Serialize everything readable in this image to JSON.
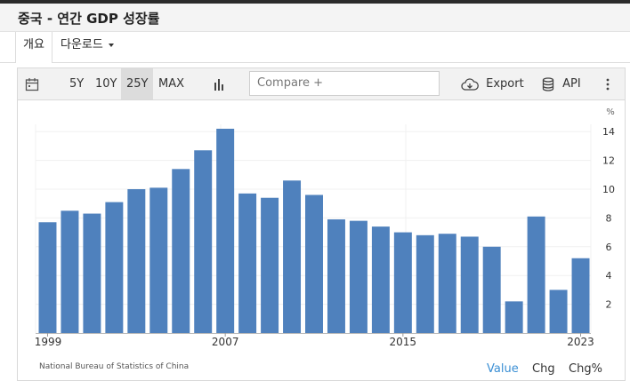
{
  "page": {
    "title": "중국 - 연간 GDP 성장률"
  },
  "tabs": {
    "overview": "개요",
    "download": "다운로드"
  },
  "toolbar": {
    "calendar_icon": "calendar-icon",
    "ranges": [
      "5Y",
      "10Y",
      "25Y",
      "MAX"
    ],
    "active_range": "25Y",
    "chart_type_icon": "bar-chart-icon",
    "compare_placeholder": "Compare +",
    "export_label": "Export",
    "export_icon": "cloud-download-icon",
    "api_label": "API",
    "api_icon": "database-icon",
    "more_icon": "vertical-dots-icon"
  },
  "chart_data": {
    "type": "bar",
    "title": "",
    "unit_label": "%",
    "categories": [
      "1999",
      "2000",
      "2001",
      "2002",
      "2003",
      "2004",
      "2005",
      "2006",
      "2007",
      "2008",
      "2009",
      "2010",
      "2011",
      "2012",
      "2013",
      "2014",
      "2015",
      "2016",
      "2017",
      "2018",
      "2019",
      "2020",
      "2021",
      "2022",
      "2023"
    ],
    "values": [
      7.7,
      8.5,
      8.3,
      9.1,
      10.0,
      10.1,
      11.4,
      12.7,
      14.2,
      9.7,
      9.4,
      10.6,
      9.6,
      7.9,
      7.8,
      7.4,
      7.0,
      6.8,
      6.9,
      6.7,
      6.0,
      2.2,
      8.1,
      3.0,
      5.2
    ],
    "x_tick_labels": [
      "1999",
      "2007",
      "2015",
      "2023"
    ],
    "y_ticks": [
      2,
      4,
      6,
      8,
      10,
      12,
      14
    ],
    "ylim": [
      0,
      15
    ],
    "bar_color": "#4f81bd",
    "grid": true
  },
  "footer": {
    "source": "National Bureau of Statistics of China",
    "value_label": "Value",
    "chg_label": "Chg",
    "chgpct_label": "Chg%",
    "value_color": "#3b8fd4"
  }
}
